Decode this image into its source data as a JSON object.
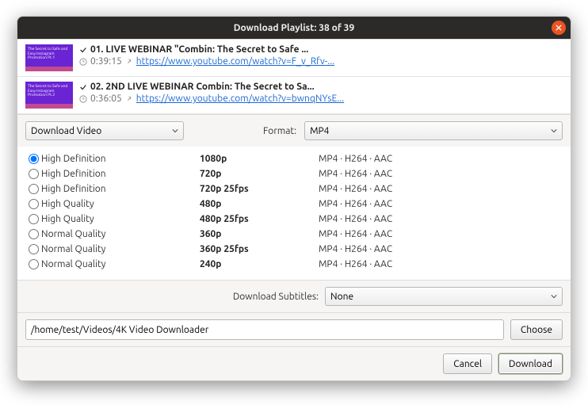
{
  "title": "Download Playlist: 38 of 39",
  "playlist": [
    {
      "thumb_text": "The Secret to Safe and Easy Instagram Promotion Pt.1",
      "title": "01. LIVE WEBINAR \"Combin: The Secret to Safe ...",
      "duration": "0:39:15",
      "url": "https://www.youtube.com/watch?v=F_v_Rfv-..."
    },
    {
      "thumb_text": "The Secret to Safe and Easy Instagram Promotion Pt.2",
      "title": "02. 2ND LIVE WEBINAR Combin: The Secret to Sa...",
      "duration": "0:36:05",
      "url": "https://www.youtube.com/watch?v=bwnqNYsE..."
    }
  ],
  "action_dropdown": "Download Video",
  "format_label": "Format:",
  "format_value": "MP4",
  "qualities": [
    {
      "name": "High Definition",
      "res": "1080p",
      "codec": "MP4 · H264 · AAC",
      "selected": true
    },
    {
      "name": "High Definition",
      "res": "720p",
      "codec": "MP4 · H264 · AAC",
      "selected": false
    },
    {
      "name": "High Definition",
      "res": "720p 25fps",
      "codec": "MP4 · H264 · AAC",
      "selected": false
    },
    {
      "name": "High Quality",
      "res": "480p",
      "codec": "MP4 · H264 · AAC",
      "selected": false
    },
    {
      "name": "High Quality",
      "res": "480p 25fps",
      "codec": "MP4 · H264 · AAC",
      "selected": false
    },
    {
      "name": "Normal Quality",
      "res": "360p",
      "codec": "MP4 · H264 · AAC",
      "selected": false
    },
    {
      "name": "Normal Quality",
      "res": "360p 25fps",
      "codec": "MP4 · H264 · AAC",
      "selected": false
    },
    {
      "name": "Normal Quality",
      "res": "240p",
      "codec": "MP4 · H264 · AAC",
      "selected": false
    }
  ],
  "subtitles_label": "Download Subtitles:",
  "subtitles_value": "None",
  "path_value": "/home/test/Videos/4K Video Downloader",
  "choose_label": "Choose",
  "cancel_label": "Cancel",
  "download_label": "Download"
}
